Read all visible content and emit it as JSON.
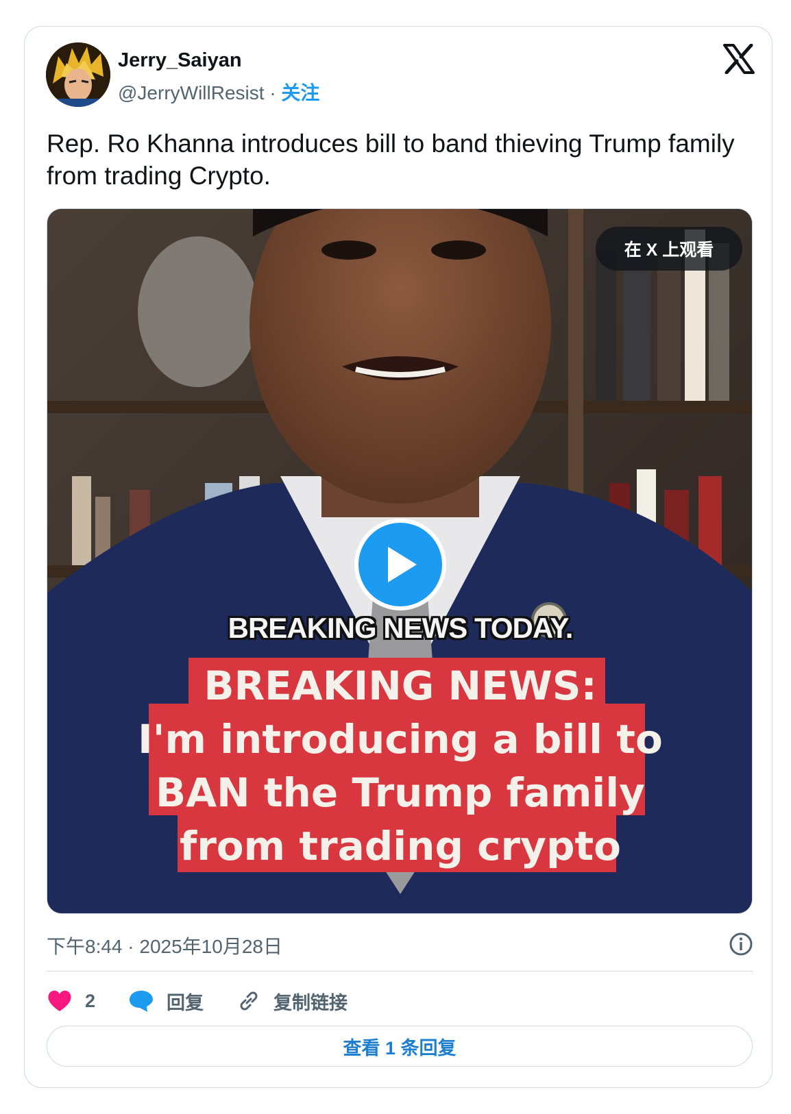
{
  "author": {
    "name": "Jerry_Saiyan",
    "handle": "@JerryWillResist",
    "separator": "·",
    "follow_label": "关注"
  },
  "tweet": {
    "text": "Rep. Ro Khanna introduces bill to band thieving Trump family from trading Crypto."
  },
  "media": {
    "watch_on_x_label": "在 X 上观看",
    "caption_top": "BREAKING NEWS TODAY.",
    "caption_lines": [
      "BREAKING NEWS:",
      "I'm introducing a bill to",
      "BAN the Trump family",
      "from trading crypto"
    ]
  },
  "meta": {
    "timestamp": "下午8:44 · 2025年10月28日"
  },
  "actions": {
    "like_count": "2",
    "reply_label": "回复",
    "copy_link_label": "复制链接"
  },
  "view_replies_label": "查看 1 条回复",
  "colors": {
    "accent": "#1d9bf0",
    "like": "#f91880",
    "caption_bg": "#d8373f"
  },
  "icons": [
    "x-logo-icon",
    "play-icon",
    "info-icon",
    "heart-icon",
    "reply-bubble-icon",
    "link-icon"
  ]
}
